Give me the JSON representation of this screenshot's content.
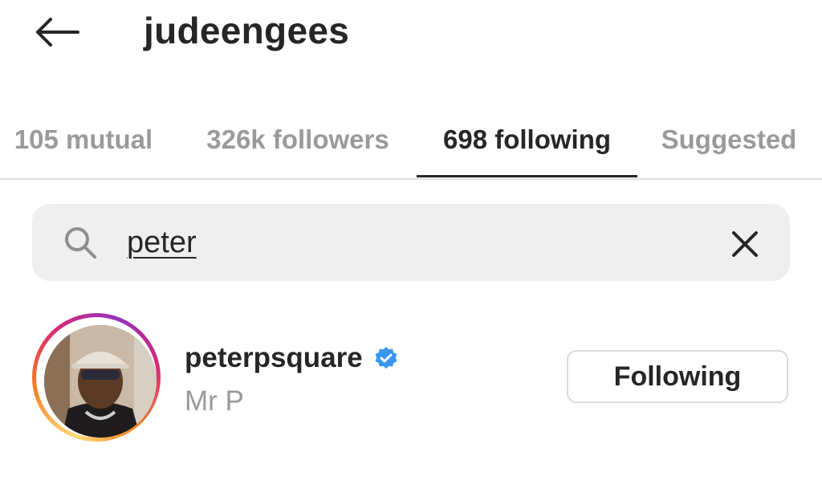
{
  "header": {
    "title": "judeengees",
    "back_icon": "arrow-left-icon"
  },
  "tabs": [
    {
      "label": "105 mutual",
      "active": false
    },
    {
      "label": "326k followers",
      "active": false
    },
    {
      "label": "698 following",
      "active": true
    },
    {
      "label": "Suggested",
      "active": false
    }
  ],
  "search": {
    "value": "peter",
    "icon": "search-icon",
    "clear_icon": "close-icon"
  },
  "results": [
    {
      "handle": "peterpsquare",
      "display_name": "Mr P",
      "verified": true,
      "button_label": "Following"
    }
  ],
  "colors": {
    "text_primary": "#262626",
    "text_secondary": "#9a9a9a",
    "verified_blue": "#3897f0",
    "search_bg": "#efefef",
    "divider": "#dbdbdb"
  }
}
